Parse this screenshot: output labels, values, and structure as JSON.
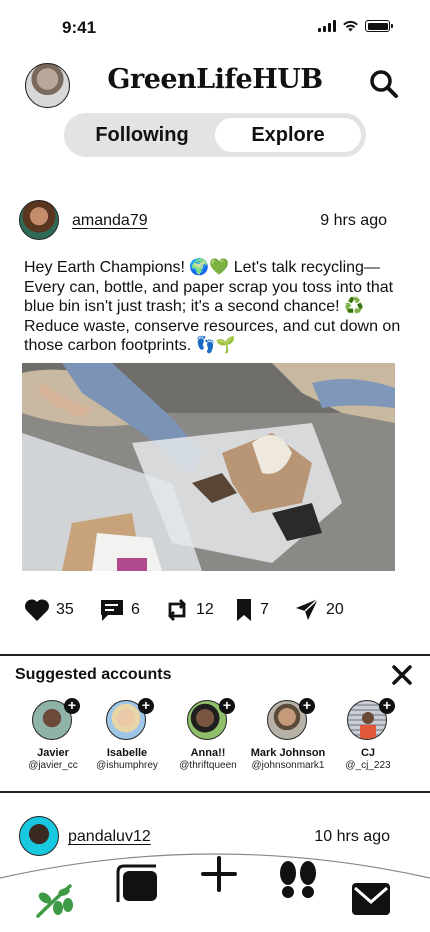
{
  "status_bar": {
    "time": "9:41"
  },
  "header": {
    "app_title": "GreenLifeHUB"
  },
  "feed_tabs": [
    {
      "label": "Following",
      "active": false
    },
    {
      "label": "Explore",
      "active": true
    }
  ],
  "post": {
    "username": "amanda79",
    "time_ago": "9 hrs ago",
    "text": "Hey Earth Champions! 🌍💚 Let's talk recycling—Every can, bottle, and paper scrap you toss into that blue bin isn't just trash; it's a second chance! ♻️ Reduce waste, conserve resources, and cut down on those carbon footprints. 👣🌱",
    "actions": {
      "likes": "35",
      "comments": "6",
      "reposts": "12",
      "saves": "7",
      "shares": "20"
    }
  },
  "suggested": {
    "title": "Suggested accounts",
    "accounts": [
      {
        "name": "Javier",
        "handle": "@javier_cc"
      },
      {
        "name": "Isabelle",
        "handle": "@ishumphrey"
      },
      {
        "name": "Anna!!",
        "handle": "@thriftqueen"
      },
      {
        "name": "Mark Johnson",
        "handle": "@johnsonmark1"
      },
      {
        "name": "CJ",
        "handle": "@_cj_223"
      }
    ]
  },
  "post2": {
    "username": "pandaluv12",
    "time_ago": "10 hrs ago"
  },
  "icons": {
    "nav_home": "leaf-branch-icon",
    "nav_feed": "cards-icon",
    "nav_create": "plus-icon",
    "nav_footprint": "footprints-icon",
    "nav_messages": "envelope-icon"
  },
  "colors": {
    "accent_green": "#3f9a45",
    "segment_bg": "#e3e3e3"
  }
}
